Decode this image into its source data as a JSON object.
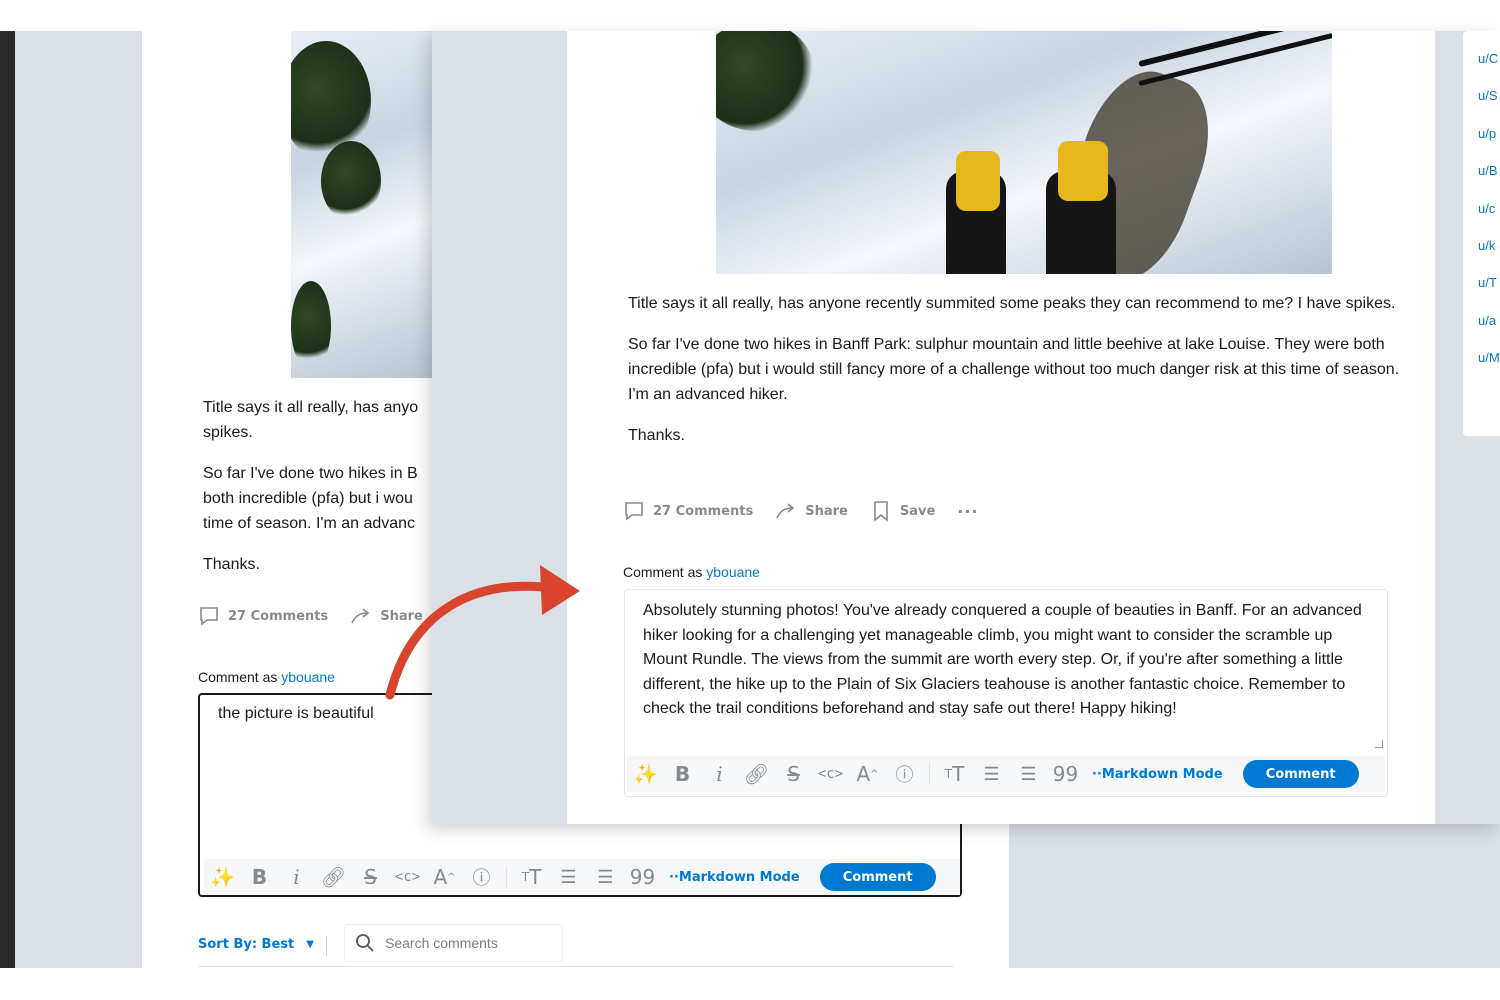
{
  "post": {
    "body_paragraphs": [
      "Title says it all really, has anyone recently summited some peaks they can recommend to me? I have spikes.",
      "So far I've done two hikes in Banff Park: sulphur mountain and little beehive at lake Louise. They were both incredible (pfa) but i would still fancy more of a challenge without too much danger risk at this time of season. I'm an advanced hiker.",
      "Thanks."
    ],
    "comments_label": "27 Comments",
    "share_label": "Share",
    "save_label": "Save",
    "more_label": "···"
  },
  "background_view": {
    "body_paragraphs_truncated": [
      "Title says it all really, has anyo",
      "spikes.",
      "So far I've done two hikes in B",
      "both incredible (pfa) but i wou",
      "time of season. I'm an advanc",
      "Thanks."
    ],
    "comment_as_prefix": "Comment as",
    "username": "ybouane",
    "editor_text": "the picture is beautiful",
    "markdown_mode_label": "··Markdown Mode",
    "comment_button_label": "Comment",
    "sort_label": "Sort By: Best",
    "search_placeholder": "Search comments"
  },
  "foreground_view": {
    "comment_as_prefix": "Comment as",
    "username": "ybouane",
    "editor_text": "Absolutely stunning photos! You've already conquered a couple of beauties in Banff. For an advanced hiker looking for a challenging yet manageable climb, you might want to consider the scramble up Mount Rundle. The views from the summit are worth every step. Or, if you're after something a little different, the hike up to the Plain of Six Glaciers teahouse is another fantastic choice. Remember to check the trail conditions beforehand and stay safe out there! Happy hiking!",
    "markdown_mode_label": "··Markdown Mode",
    "comment_button_label": "Comment"
  },
  "toolbar_icons": [
    "magic-wand-icon",
    "bold-icon",
    "italic-icon",
    "link-icon",
    "strikethrough-icon",
    "inline-code-icon",
    "superscript-icon",
    "spoiler-icon",
    "heading-icon",
    "bulleted-list-icon",
    "numbered-list-icon",
    "quote-icon"
  ],
  "sidebar": {
    "users": [
      "u/C",
      "u/S",
      "u/p",
      "u/B",
      "u/c",
      "u/k",
      "u/T",
      "u/a",
      "u/M"
    ]
  },
  "colors": {
    "accent": "#0079d3",
    "page_bg": "#dae0e6",
    "arrow": "#d9442f",
    "muted": "#878a8c"
  }
}
